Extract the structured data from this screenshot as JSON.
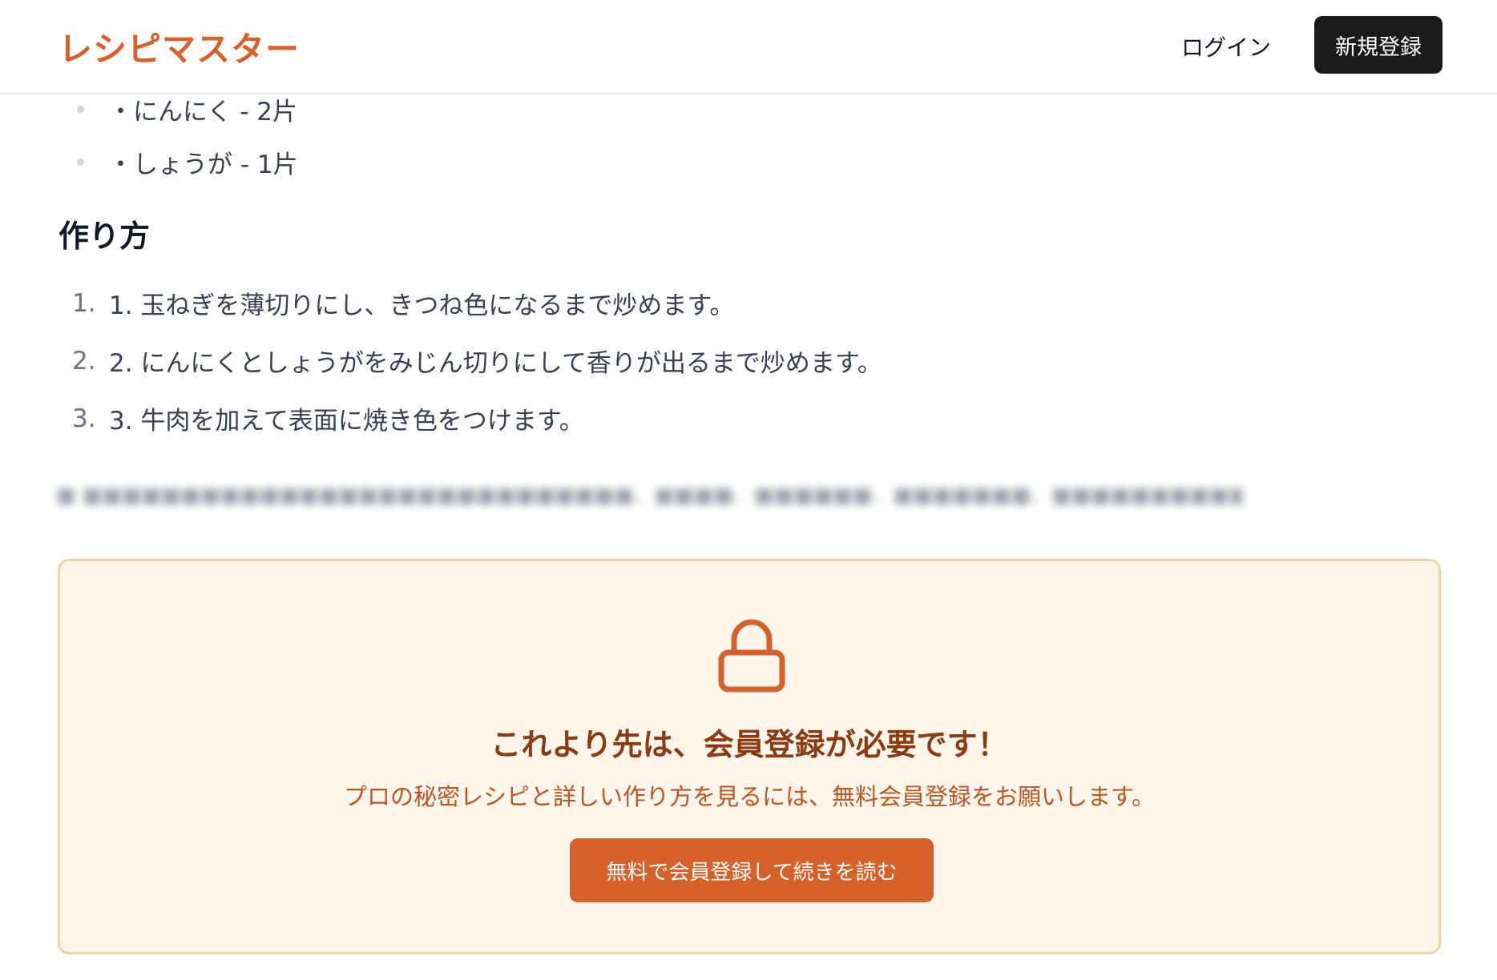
{
  "header": {
    "logo": "レシピマスター",
    "login_label": "ログイン",
    "signup_label": "新規登録"
  },
  "ingredients": [
    "・にんにく - 2片",
    "・しょうが - 1片"
  ],
  "method": {
    "title": "作り方",
    "steps": [
      {
        "num": "1.",
        "text": "1. 玉ねぎを薄切りにし、きつね色になるまで炒めます。"
      },
      {
        "num": "2.",
        "text": "2. にんにくとしょうがをみじん切りにして香りが出るまで炒めます。"
      },
      {
        "num": "3.",
        "text": "3. 牛肉を加えて表面に焼き色をつけます。"
      }
    ]
  },
  "paywall": {
    "title": "これより先は、会員登録が必要です！",
    "description": "プロの秘密レシピと詳しい作り方を見るには、無料会員登録をお願いします。",
    "cta_label": "無料で会員登録して続きを読む",
    "icon": "lock-icon"
  },
  "colors": {
    "brand": "#d7612b",
    "paywall_bg": "#fdf6ec",
    "paywall_border": "#f6d3a3",
    "paywall_title": "#8b3a12"
  }
}
